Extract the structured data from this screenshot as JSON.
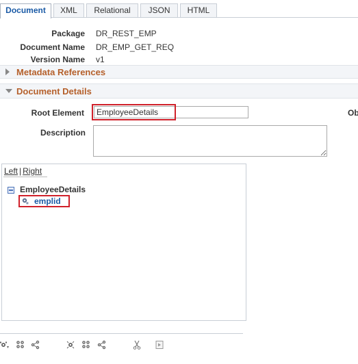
{
  "tabs": [
    {
      "label": "Document",
      "active": true
    },
    {
      "label": "XML",
      "active": false
    },
    {
      "label": "Relational",
      "active": false
    },
    {
      "label": "JSON",
      "active": false
    },
    {
      "label": "HTML",
      "active": false
    }
  ],
  "info": {
    "package_label": "Package",
    "package_value": "DR_REST_EMP",
    "document_name_label": "Document Name",
    "document_name_value": "DR_EMP_GET_REQ",
    "version_name_label": "Version Name",
    "version_name_value": "v1"
  },
  "metadata_section": {
    "title": "Metadata References",
    "expanded": false
  },
  "details_section": {
    "title": "Document Details",
    "expanded": true
  },
  "form": {
    "root_element_label": "Root Element",
    "root_element_value": "EmployeeDetails",
    "description_label": "Description",
    "description_value": "",
    "right_cut_label": "Ob"
  },
  "tree": {
    "left_link": "Left",
    "separator": "|",
    "right_link": "Right",
    "root": "EmployeeDetails",
    "children": [
      "emplid"
    ]
  },
  "toolbar": {
    "icons": [
      "add-element-icon",
      "add-collection-icon",
      "add-attribute-icon",
      "insert-element-icon",
      "insert-collection-icon",
      "insert-attribute-icon",
      "cut-icon",
      "paste-icon"
    ]
  },
  "colors": {
    "active_tab_text": "#1a5aa6",
    "section_title": "#b5602b",
    "highlight_box": "#d0202a",
    "link_blue": "#1a5aa6"
  }
}
